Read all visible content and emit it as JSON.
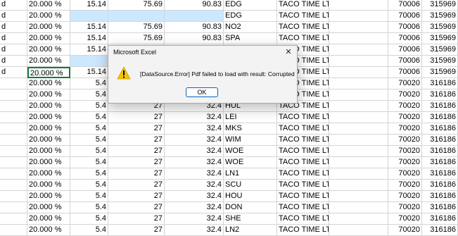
{
  "sheet": {
    "rows": [
      {
        "a": "d",
        "b": "20.000 %",
        "c": "15.14",
        "d": "75.69",
        "e": "90.83",
        "f": "EDG",
        "g": "TACO TIME LTD",
        "i": "70006",
        "j": "315969"
      },
      {
        "a": "d",
        "b": "20.000 %",
        "c": "",
        "d": "",
        "e": "",
        "f": "EDG",
        "g": "TACO TIME LTD",
        "i": "70006",
        "j": "315969",
        "sel": true
      },
      {
        "a": "d",
        "b": "20.000 %",
        "c": "15.14",
        "d": "75.69",
        "e": "90.83",
        "f": "NO2",
        "g": "TACO TIME LTD",
        "i": "70006",
        "j": "315969"
      },
      {
        "a": "d",
        "b": "20.000 %",
        "c": "15.14",
        "d": "75.69",
        "e": "90.83",
        "f": "SPA",
        "g": "TACO TIME LTD",
        "i": "70006",
        "j": "315969"
      },
      {
        "a": "d",
        "b": "20.000 %",
        "c": "15.14",
        "d": "",
        "e": "",
        "f": "",
        "g": "TACO TIME LTD",
        "i": "70006",
        "j": "315969"
      },
      {
        "a": "d",
        "b": "20.000 %",
        "c": "",
        "d": "",
        "e": "",
        "f": "",
        "g": "TACO TIME LTD",
        "i": "70006",
        "j": "315969",
        "sel": true
      },
      {
        "a": "d",
        "b": "20.000 %",
        "c": "15.14",
        "d": "",
        "e": "",
        "f": "",
        "g": "TACO TIME LTD",
        "i": "70006",
        "j": "315969",
        "active": true
      },
      {
        "a": "",
        "b": "20.000 %",
        "c": "5.4",
        "d": "",
        "e": "",
        "f": "",
        "g": "TACO TIME LTD",
        "i": "70020",
        "j": "316186"
      },
      {
        "a": "",
        "b": "20.000 %",
        "c": "5.4",
        "d": "",
        "e": "",
        "f": "",
        "g": "TACO TIME LTD",
        "i": "70020",
        "j": "316186"
      },
      {
        "a": "",
        "b": "20.000 %",
        "c": "5.4",
        "d": "27",
        "e": "32.4",
        "f": "HUL",
        "g": "TACO TIME LTD",
        "i": "70020",
        "j": "316186"
      },
      {
        "a": "",
        "b": "20.000 %",
        "c": "5.4",
        "d": "27",
        "e": "32.4",
        "f": "LEI",
        "g": "TACO TIME LTD",
        "i": "70020",
        "j": "316186"
      },
      {
        "a": "",
        "b": "20.000 %",
        "c": "5.4",
        "d": "27",
        "e": "32.4",
        "f": "MKS",
        "g": "TACO TIME LTD",
        "i": "70020",
        "j": "316186"
      },
      {
        "a": "",
        "b": "20.000 %",
        "c": "5.4",
        "d": "27",
        "e": "32.4",
        "f": "WIM",
        "g": "TACO TIME LTD",
        "i": "70020",
        "j": "316186"
      },
      {
        "a": "",
        "b": "20.000 %",
        "c": "5.4",
        "d": "27",
        "e": "32.4",
        "f": "WOE",
        "g": "TACO TIME LTD",
        "i": "70020",
        "j": "316186"
      },
      {
        "a": "",
        "b": "20.000 %",
        "c": "5.4",
        "d": "27",
        "e": "32.4",
        "f": "WOE",
        "g": "TACO TIME LTD",
        "i": "70020",
        "j": "316186"
      },
      {
        "a": "",
        "b": "20.000 %",
        "c": "5.4",
        "d": "27",
        "e": "32.4",
        "f": "LN1",
        "g": "TACO TIME LTD",
        "i": "70020",
        "j": "316186"
      },
      {
        "a": "",
        "b": "20.000 %",
        "c": "5.4",
        "d": "27",
        "e": "32.4",
        "f": "SCU",
        "g": "TACO TIME LTD",
        "i": "70020",
        "j": "316186"
      },
      {
        "a": "",
        "b": "20.000 %",
        "c": "5.4",
        "d": "27",
        "e": "32.4",
        "f": "HOU",
        "g": "TACO TIME LTD",
        "i": "70020",
        "j": "316186"
      },
      {
        "a": "",
        "b": "20.000 %",
        "c": "5.4",
        "d": "27",
        "e": "32.4",
        "f": "DON",
        "g": "TACO TIME LTD",
        "i": "70020",
        "j": "316186"
      },
      {
        "a": "",
        "b": "20.000 %",
        "c": "5.4",
        "d": "27",
        "e": "32.4",
        "f": "SHE",
        "g": "TACO TIME LTD",
        "i": "70020",
        "j": "316186"
      },
      {
        "a": "",
        "b": "20.000 %",
        "c": "5.4",
        "d": "27",
        "e": "32.4",
        "f": "LN2",
        "g": "TACO TIME LTD",
        "i": "70020",
        "j": "316186"
      }
    ]
  },
  "dialog": {
    "title": "Microsoft Excel",
    "close_glyph": "✕",
    "message": "[DataSource.Error] Pdf failed to load with result: Corrupted",
    "ok_label": "OK",
    "icon": "warning-icon",
    "icon_color": "#f2c200"
  }
}
